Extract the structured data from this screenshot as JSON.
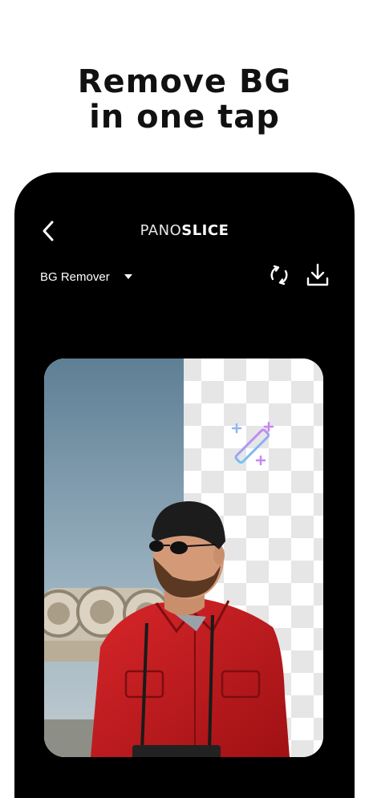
{
  "promo": {
    "headline_line1": "Remove BG",
    "headline_line2": "in one tap"
  },
  "header": {
    "title_light": "PANO",
    "title_bold": "SLICE",
    "back_icon": "chevron-left-icon"
  },
  "toolbar": {
    "mode_label": "BG Remover",
    "mode_caret_icon": "caret-down-icon",
    "reset_icon": "refresh-icon",
    "download_icon": "download-icon"
  },
  "preview": {
    "image_description_icon": "photo-preview",
    "magic_icon": "magic-wand-icon"
  },
  "colors": {
    "background": "#ffffff",
    "phone": "#000000",
    "shirt": "#c41a1c",
    "sky": "#5d7f97",
    "wand_gradient_start": "#6cc6f5",
    "wand_gradient_end": "#c985f2"
  }
}
